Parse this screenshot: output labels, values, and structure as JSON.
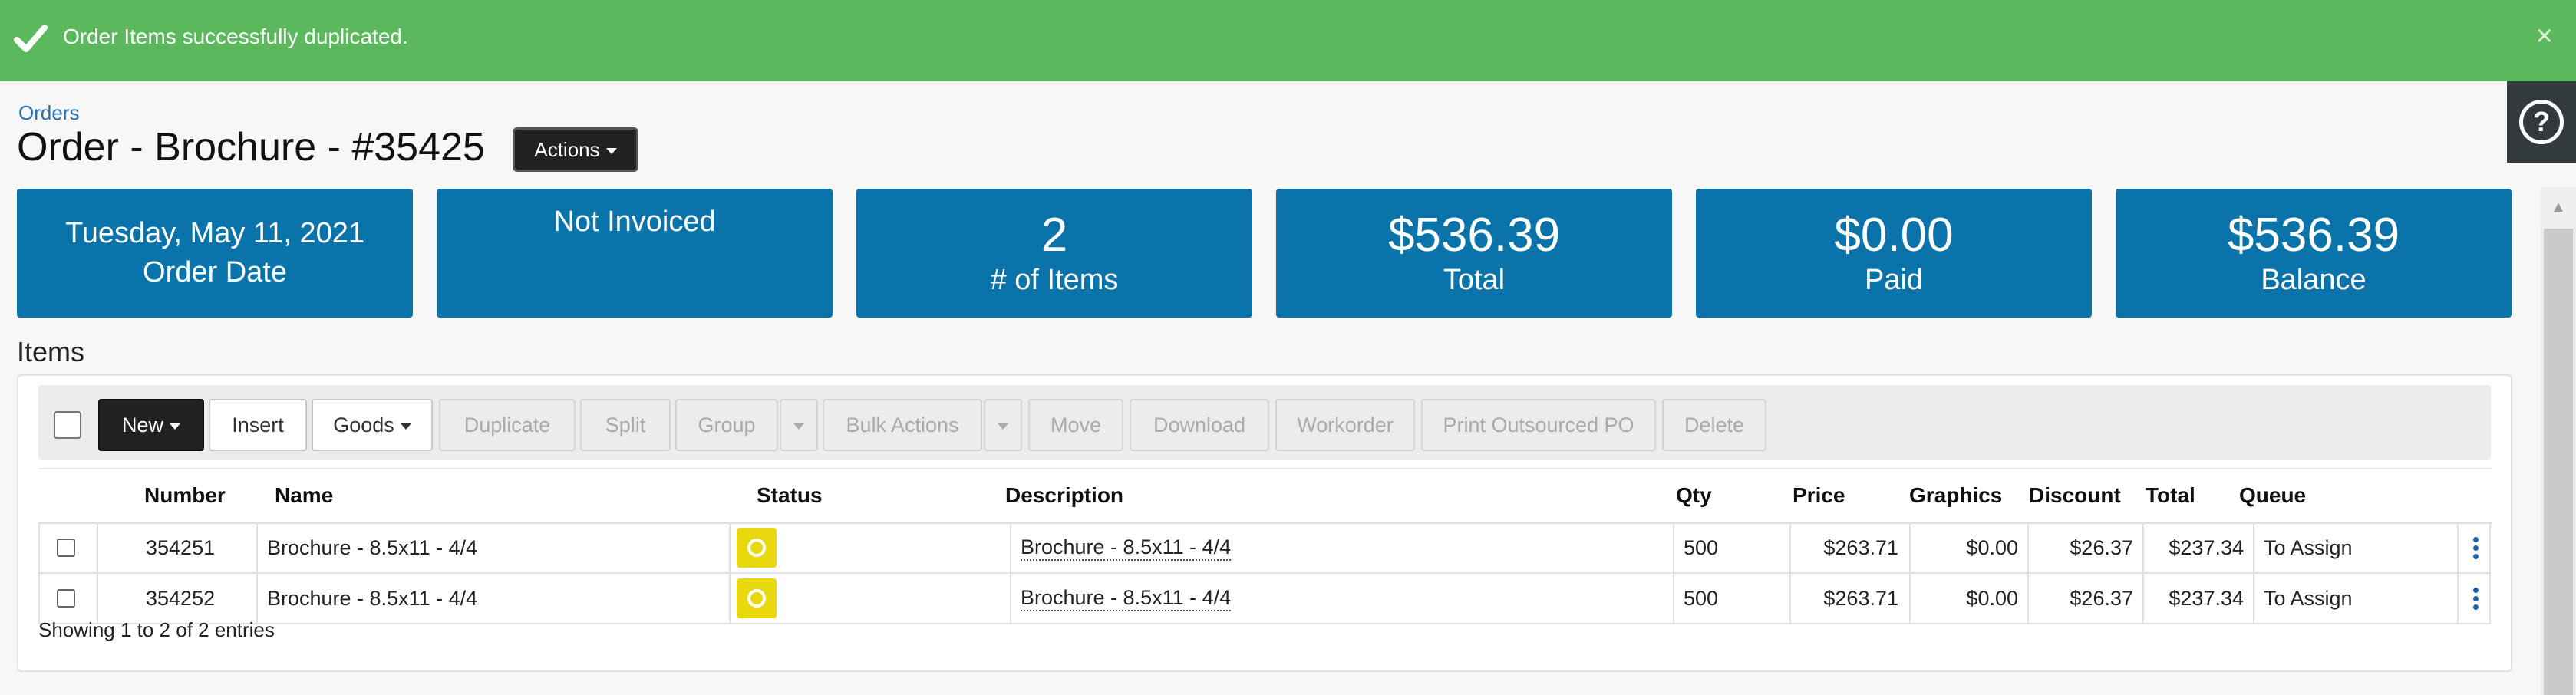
{
  "alert": {
    "message": "Order Items successfully duplicated.",
    "close": "×",
    "icon": "check-icon"
  },
  "help": {
    "label": "?"
  },
  "breadcrumb": "Orders",
  "title": "Order - Brochure - #35425",
  "actions_label": "Actions",
  "cards": {
    "date": {
      "line1": "Tuesday, May 11, 2021",
      "line2": "Order Date"
    },
    "invoice": {
      "line1": "Not Invoiced"
    },
    "items": {
      "value": "2",
      "label": "# of Items"
    },
    "total": {
      "value": "$536.39",
      "label": "Total"
    },
    "paid": {
      "value": "$0.00",
      "label": "Paid"
    },
    "balance": {
      "value": "$536.39",
      "label": "Balance"
    }
  },
  "items_heading": "Items",
  "toolbar": {
    "new": "New",
    "insert": "Insert",
    "goods": "Goods",
    "duplicate": "Duplicate",
    "split": "Split",
    "group": "Group",
    "bulk_actions": "Bulk Actions",
    "move": "Move",
    "download": "Download",
    "workorder": "Workorder",
    "print_po": "Print Outsourced PO",
    "delete": "Delete"
  },
  "table": {
    "columns": [
      "Number",
      "Name",
      "Status",
      "Description",
      "Qty",
      "Price",
      "Graphics",
      "Discount",
      "Total",
      "Queue"
    ],
    "rows": [
      {
        "number": "354251",
        "name": "Brochure - 8.5x11 - 4/4",
        "description": "Brochure - 8.5x11 - 4/4",
        "qty": "500",
        "price": "$263.71",
        "graphics": "$0.00",
        "discount": "$26.37",
        "total": "$237.34",
        "queue": "To Assign"
      },
      {
        "number": "354252",
        "name": "Brochure - 8.5x11 - 4/4",
        "description": "Brochure - 8.5x11 - 4/4",
        "qty": "500",
        "price": "$263.71",
        "graphics": "$0.00",
        "discount": "$26.37",
        "total": "$237.34",
        "queue": "To Assign"
      }
    ]
  },
  "footer": "Showing 1 to 2 of 2 entries",
  "colors": {
    "success": "#5cb85c",
    "card": "#0a74aa",
    "status": "#e8d80d",
    "link": "#2a6fb0"
  }
}
